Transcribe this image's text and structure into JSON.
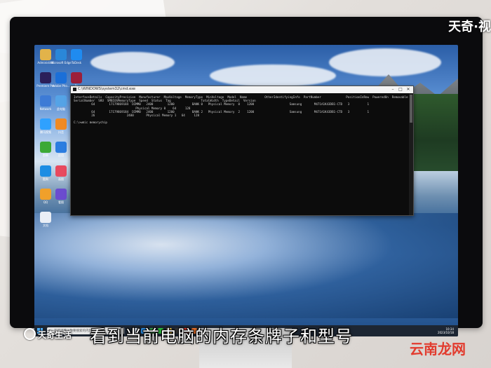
{
  "desktop": {
    "icons": [
      {
        "label": "Administrat",
        "icon": "user-folder-icon",
        "color": "#e2b34a"
      },
      {
        "label": "Microsoft Edge",
        "icon": "edge-icon",
        "color": "#2a87d8"
      },
      {
        "label": "ToDesk",
        "icon": "remote-desktop-icon",
        "color": "#1f8bf0"
      },
      {
        "label": "Premiere Pro",
        "icon": "premiere-icon",
        "color": "#2b1f5a"
      },
      {
        "label": "Adobe Pho...",
        "icon": "app-icon",
        "color": "#1b6fd8"
      },
      {
        "label": "Ps",
        "icon": "red-app-icon",
        "color": "#9c1f3a"
      },
      {
        "label": "Network",
        "icon": "network-icon",
        "color": "#3d7bd6"
      },
      {
        "label": "此电脑",
        "icon": "computer-icon",
        "color": "#55a3e6"
      },
      {
        "label": "回收站",
        "icon": "recycle-bin-icon",
        "color": "#8fb0cf"
      },
      {
        "label": "腾讯视频",
        "icon": "video-icon",
        "color": "#2fa1ff"
      },
      {
        "label": "抖音",
        "icon": "scissors-icon",
        "color": "#f08a24"
      },
      {
        "label": "微信",
        "icon": "wechat-icon",
        "color": "#2dbb3c"
      },
      {
        "label": "剪映",
        "icon": "plus-icon",
        "color": "#3ba936"
      },
      {
        "label": "应用",
        "icon": "shield-icon",
        "color": "#2b7de0"
      },
      {
        "label": "CDR",
        "icon": "multicolor-icon",
        "color": "#d64a8f"
      },
      {
        "label": "酷狗",
        "icon": "k-icon",
        "color": "#1c8de3"
      },
      {
        "label": "画图",
        "icon": "paint-icon",
        "color": "#e84a5f"
      },
      {
        "label": "便签",
        "icon": "notes-icon",
        "color": "#f2c83a"
      },
      {
        "label": "QQ",
        "icon": "sun-icon",
        "color": "#f0a02a"
      },
      {
        "label": "看图",
        "icon": "photo-icon",
        "color": "#6b4ccf"
      },
      {
        "label": "剪映",
        "icon": "capcut-icon",
        "color": "#111111"
      },
      {
        "label": "文档",
        "icon": "document-icon",
        "color": "#e9eef6"
      }
    ]
  },
  "cmd": {
    "title": "C:\\WINDOWS\\system32\\cmd.exe",
    "lines": [
      "InterfaceDetails  CapacityPrecision  Manufacturer  MaxVoltage  MemoryType  MinVoltage  Model  Name          OtherIdentifyingInfo  PartNumber              PositionInRow  PoweredOn  Removable  Replaceable",
      "SerialNumber  SKU  SMBIOSMemoryType  Speed  Status  Tag                 TotalWidth  TypeDetail  Version",
      "          64        17179869184  DIMM0   2400        1200          BANK 0   Physical Memory  0    1200                    Samsung       M471A1K43DB1-CTD   3          1",
      "                                   Physical Memory 0    64     128",
      "          64        17179869184  DIMM0   2400        1200          BANK 2   Physical Memory  2    1200                    Samsung       M471A1K43DB1-CTD   3          1",
      "          26                  2400       Physical Memory 1   64     128",
      "",
      "C:\\>wmic memorychip",
      ""
    ],
    "controls": {
      "minimize": "–",
      "maximize": "□",
      "close": "✕"
    }
  },
  "taskbar": {
    "search_placeholder": "在这里输入你要搜索的内容",
    "time": "10:34",
    "date": "2023/10/18",
    "apps": [
      {
        "icon": "task-view-icon",
        "color": "#cfd8e3"
      },
      {
        "icon": "edge-icon",
        "color": "#2a87d8"
      },
      {
        "icon": "chrome-icon",
        "color": "#3aa54a"
      },
      {
        "icon": "wechat-icon",
        "color": "#2dbb3c"
      },
      {
        "icon": "folder-icon",
        "color": "#f1c044"
      },
      {
        "icon": "terminal-icon",
        "color": "#333333"
      },
      {
        "icon": "wps-icon",
        "color": "#d8352a"
      },
      {
        "icon": "app-icon",
        "color": "#e56f2b"
      },
      {
        "icon": "app-icon",
        "color": "#6a6a6a"
      },
      {
        "icon": "app-icon",
        "color": "#4a8fe0"
      }
    ]
  },
  "overlay": {
    "caption": "看到当前电脑的内存条牌子和型号",
    "logo_left": "天奇生活",
    "brand_top": "天奇·视",
    "brand_bottom": "云南龙网"
  }
}
